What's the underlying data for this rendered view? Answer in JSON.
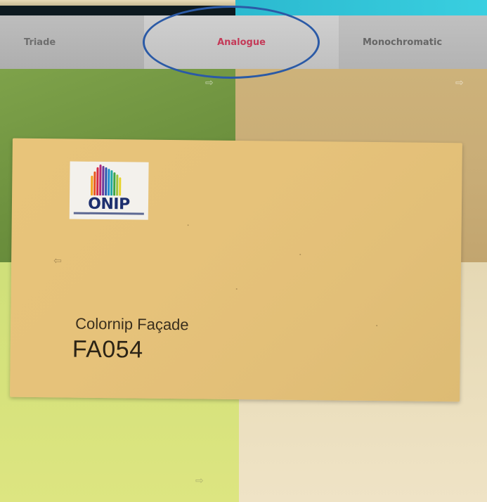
{
  "tabs": [
    {
      "label": "Triade",
      "active": false
    },
    {
      "label": "Analogue",
      "active": true
    },
    {
      "label": "Monochromatic",
      "active": false
    }
  ],
  "active_tab_color": "#c43a58",
  "highlight_color": "#2b5aa6",
  "swatches": {
    "top_left": "#6b8f3d",
    "top_right": "#c9ad77",
    "bottom_left": "#d6e27c",
    "bottom_right": "#ebdfbe",
    "card": "#e6c27a"
  },
  "arrows": {
    "top_left": "⇨",
    "top_right": "⇨",
    "left": "⇦",
    "bottom": "⇨"
  },
  "card": {
    "logo_text": "ONIP",
    "range_name": "Colornip Façade",
    "code": "FA054"
  }
}
